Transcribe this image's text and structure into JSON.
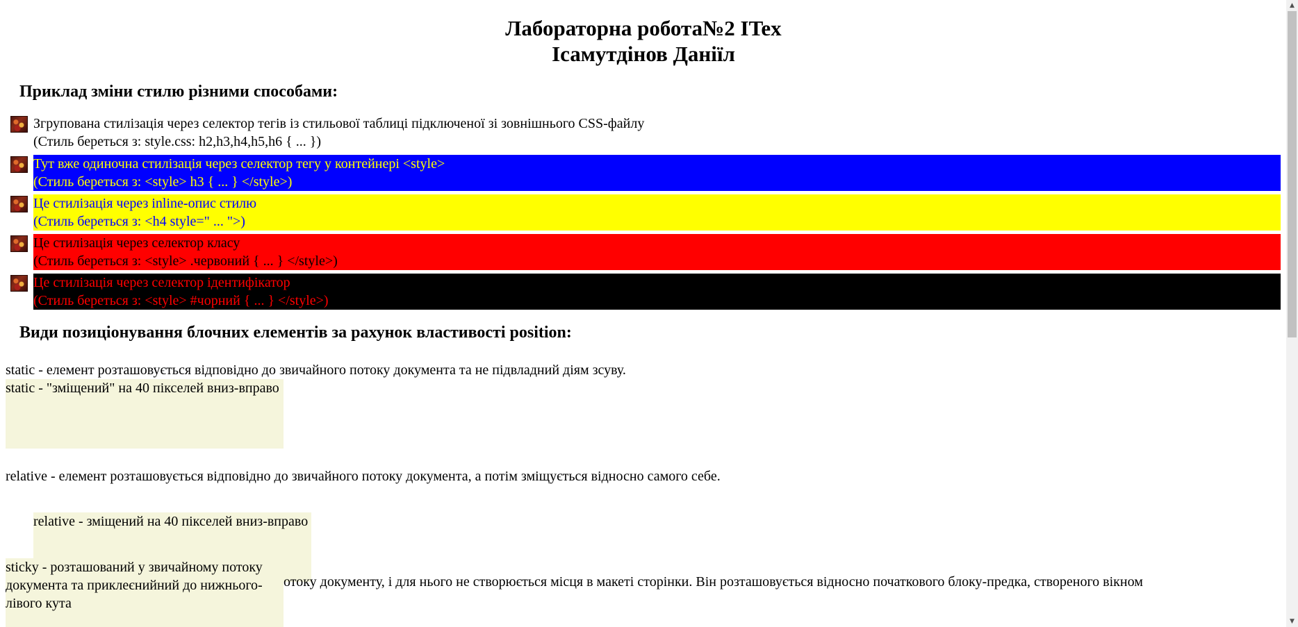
{
  "header": {
    "title_line1": "Лабораторна робота№2 ITex",
    "title_line2": "Ісамутдінов Даніїл"
  },
  "styles_section": {
    "heading": "Приклад зміни стилю різними способами:",
    "items": [
      {
        "line1": "Згрупована стилізація через селектор тегів із стильової таблиці підключеної зі зовнішнього CSS-файлу",
        "line2": "(Стиль береться з: style.css: h2,h3,h4,h5,h6 { ... })",
        "background": "transparent",
        "color": "#000000"
      },
      {
        "line1": "Тут вже одиночна стилізація через селектор тегу у контейнері <style>",
        "line2": "(Стиль береться з: <style> h3 { ... } </style>)",
        "background": "#0000ff",
        "color": "#ffff00"
      },
      {
        "line1": "Це стилізація через inline-опис стилю",
        "line2": "(Стиль береться з: <h4 style=\" ... \">)",
        "background": "#ffff00",
        "color": "#0000ff"
      },
      {
        "line1": "Це стилізація через селектор класу",
        "line2": "(Стиль береться з: <style> .червоний { ... } </style>)",
        "background": "#ff0000",
        "color": "#000000"
      },
      {
        "line1": "Це стилізація через селектор ідентифікатор",
        "line2": "(Стиль береться з: <style> #чорний { ... } </style>)",
        "background": "#000000",
        "color": "#ff0000"
      }
    ]
  },
  "position_section": {
    "heading_prefix": "Види позиціонування блочних елементів за рахунок властивості ",
    "heading_bold": "position",
    "heading_suffix": ":",
    "static_desc": "static - елемент розташовується відповідно до звичайного потоку документа та не підвладний діям зсуву.",
    "static_box": "static - \"зміщений\" на 40 пікселей вниз-вправо",
    "relative_desc": "relative - елемент розташовується відповідно до звичайного потоку документа, а потім зміщується відносно самого себе.",
    "relative_box": "relative - зміщений на 40 пікселей вниз-вправо",
    "partial_desc": "отоку документу, і для нього не створюється місця в макеті сторінки. Він розташовується відносно початкового блоку-предка, створеного вікном",
    "sticky_box": "sticky - розташований у звичайному потоку документа та приклеєнийний до нижнього-лівого кута"
  },
  "colors": {
    "beige_box": "#f5f5dc",
    "scrollbar_track": "#f1f1f1",
    "scrollbar_thumb": "#c1c1c1"
  },
  "icons": {
    "bullet": "bullet-image-icon",
    "scroll_up": "scroll-up-arrow-icon",
    "scroll_down": "scroll-down-arrow-icon"
  }
}
